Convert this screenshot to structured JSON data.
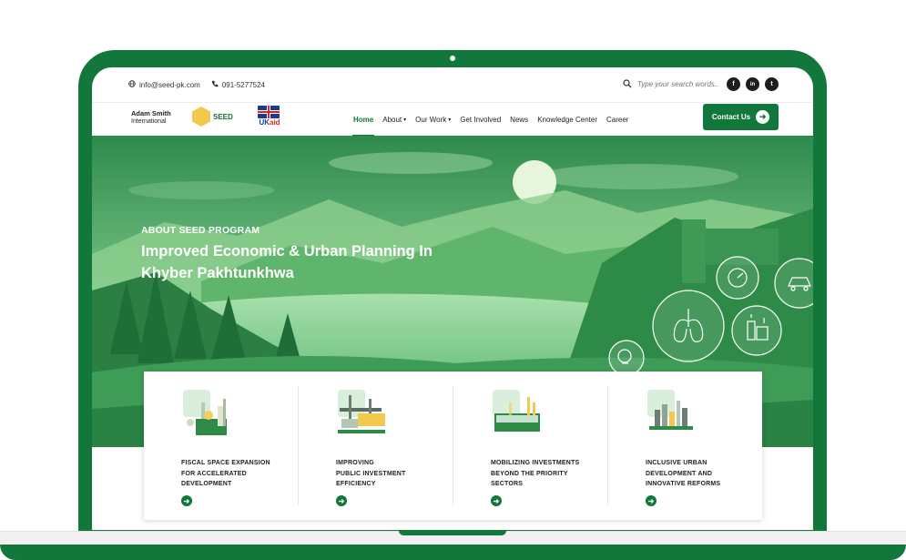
{
  "topbar": {
    "email": "info@seed-pk.com",
    "phone": "091-5277524",
    "search_placeholder": "Type your search words..",
    "social": [
      "f",
      "in",
      "t"
    ]
  },
  "logos": {
    "asi_line1": "Adam Smith",
    "asi_line2": "International",
    "seed": "SEED",
    "ukaid_uk": "UK",
    "ukaid_aid": "aid"
  },
  "nav": {
    "items": [
      {
        "label": "Home"
      },
      {
        "label": "About"
      },
      {
        "label": "Our Work"
      },
      {
        "label": "Get Involved"
      },
      {
        "label": "News"
      },
      {
        "label": "Knowledge Center"
      },
      {
        "label": "Career"
      }
    ],
    "contact_label": "Contact Us"
  },
  "hero": {
    "kicker": "ABOUT SEED PROGRAM",
    "title": "Improved Economic & Urban Planning In Khyber Pakhtunkhwa"
  },
  "cards": [
    {
      "title": "FISCAL SPACE EXPANSION\nFOR ACCELERATED\nDEVELOPMENT"
    },
    {
      "title": "IMPROVING\n PUBLIC INVESTMENT\nEFFICIENCY"
    },
    {
      "title": "MOBILIZING INVESTMENTS\nBEYOND THE PRIORITY\nSECTORS"
    },
    {
      "title": "INCLUSIVE URBAN\nDEVELOPMENT AND\nINNOVATIVE REFORMS"
    }
  ],
  "colors": {
    "brand_green": "#12773a",
    "hero_green": "#5fb874"
  }
}
